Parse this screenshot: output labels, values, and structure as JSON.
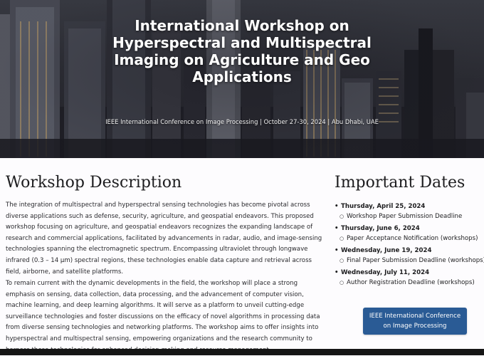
{
  "hero": {
    "title": "International Workshop on Hyperspectral and Multispectral Imaging on Agriculture and Geo Applications",
    "subtitle": "IEEE International Conference on Image Processing | October 27-30, 2024 | Abu Dhabi, UAE"
  },
  "description": {
    "heading": "Workshop Description",
    "paragraphs": [
      "The integration of multispectral and hyperspectral sensing technologies has become pivotal across diverse applications such as defense, security, agriculture, and geospatial endeavors. This proposed workshop focusing on agriculture, and geospatial endeavors recognizes the expanding landscape of research and commercial applications, facilitated by advancements in radar, audio, and image-sensing technologies spanning the electromagnetic spectrum. Encompassing ultraviolet through longwave infrared (0.3 – 14 μm) spectral regions, these technologies enable data capture and retrieval across field, airborne, and satellite platforms.",
      "To remain current with the dynamic developments in the field, the workshop will place a strong emphasis on sensing, data collection, data processing, and the advancement of computer vision, machine learning, and deep learning algorithms. It will serve as a platform to unveil cutting-edge surveillance technologies and foster discussions on the efficacy of novel algorithms in processing data from diverse sensing technologies and networking platforms. The workshop aims to offer insights into hyperspectral and multispectral sensing, empowering organizations and the research community to harness these technologies for enhanced decision-making and resource management."
    ]
  },
  "important_dates": {
    "heading": "Important Dates",
    "items": [
      {
        "date": "Thursday, April 25, 2024",
        "event": "Workshop Paper Submission Deadline"
      },
      {
        "date": "Thursday, June 6, 2024",
        "event": "Paper Acceptance Notification (workshops)"
      },
      {
        "date": "Wednesday, June 19, 2024",
        "event": "Final Paper Submission Deadline (workshops)"
      },
      {
        "date": "Wednesday, July 11, 2024",
        "event": "Author Registration Deadline (workshops)"
      }
    ]
  },
  "conference_button": {
    "label": "IEEE International Conference on Image Processing",
    "color": "#2a5b95"
  }
}
